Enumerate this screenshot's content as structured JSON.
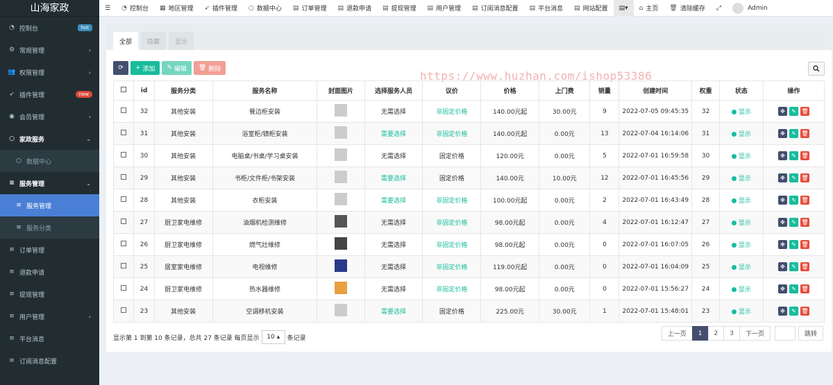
{
  "app": {
    "title": "山海家政"
  },
  "sidebar": {
    "items": [
      {
        "label": "控制台",
        "icon": "dashboard-icon",
        "badge": "hot"
      },
      {
        "label": "常规管理",
        "icon": "cogs-icon"
      },
      {
        "label": "权限管理",
        "icon": "group-icon"
      },
      {
        "label": "插件管理",
        "icon": "rocket-icon",
        "badge": "new"
      },
      {
        "label": "会员管理",
        "icon": "user-circle-icon"
      },
      {
        "label": "家政服务",
        "icon": "circle-icon"
      },
      {
        "label": "数据中心",
        "icon": "circle-outline-icon"
      },
      {
        "label": "服务管理",
        "icon": "list-icon"
      },
      {
        "label": "服务管理",
        "icon": "list-icon"
      },
      {
        "label": "服务分类",
        "icon": "list-icon"
      },
      {
        "label": "订单管理",
        "icon": "list-icon"
      },
      {
        "label": "退款申请",
        "icon": "list-icon"
      },
      {
        "label": "提现管理",
        "icon": "list-icon"
      },
      {
        "label": "用户管理",
        "icon": "list-icon"
      },
      {
        "label": "平台消息",
        "icon": "list-icon"
      },
      {
        "label": "订阅消息配置",
        "icon": "list-icon"
      }
    ]
  },
  "topbar": {
    "items": [
      "控制台",
      "地区管理",
      "插件管理",
      "数据中心",
      "订单管理",
      "退款申请",
      "提现管理",
      "用户管理",
      "订阅消息配置",
      "平台消息",
      "网站配置"
    ],
    "home": "主页",
    "clear_cache": "清除缓存",
    "user": "Admin"
  },
  "tabs": [
    "全部",
    "隐藏",
    "显示"
  ],
  "toolbar": {
    "add": "添加",
    "edit": "编辑",
    "delete": "删除"
  },
  "watermark": "https://www.huzhan.com/ishop53386",
  "table": {
    "headers": [
      "id",
      "服务分类",
      "服务名称",
      "封面图片",
      "选择服务人员",
      "议价",
      "价格",
      "上门费",
      "销量",
      "创建时间",
      "权重",
      "状态",
      "操作"
    ],
    "rows": [
      {
        "id": "32",
        "category": "其他安装",
        "name": "餐边柜安装",
        "staff": "无需选择",
        "bargain": "非固定价格",
        "price": "140.00元起",
        "fee": "30.00元",
        "sales": "9",
        "time": "2022-07-05 09:45:35",
        "weight": "32",
        "status": "显示"
      },
      {
        "id": "31",
        "category": "其他安装",
        "name": "浴室柜/镜柜安装",
        "staff": "需要选择",
        "bargain": "非固定价格",
        "price": "140.00元起",
        "fee": "0.00元",
        "sales": "13",
        "time": "2022-07-04 16:14:06",
        "weight": "31",
        "status": "显示"
      },
      {
        "id": "30",
        "category": "其他安装",
        "name": "电脑桌/书桌/学习桌安装",
        "staff": "无需选择",
        "bargain": "固定价格",
        "price": "120.00元",
        "fee": "0.00元",
        "sales": "5",
        "time": "2022-07-01 16:59:58",
        "weight": "30",
        "status": "显示"
      },
      {
        "id": "29",
        "category": "其他安装",
        "name": "书柜/文件柜/书架安装",
        "staff": "需要选择",
        "bargain": "固定价格",
        "price": "140.00元",
        "fee": "10.00元",
        "sales": "12",
        "time": "2022-07-01 16:45:56",
        "weight": "29",
        "status": "显示"
      },
      {
        "id": "28",
        "category": "其他安装",
        "name": "衣柜安装",
        "staff": "需要选择",
        "bargain": "非固定价格",
        "price": "100.00元起",
        "fee": "0.00元",
        "sales": "2",
        "time": "2022-07-01 16:43:49",
        "weight": "28",
        "status": "显示"
      },
      {
        "id": "27",
        "category": "厨卫家电维修",
        "name": "油烟机检测维修",
        "staff": "无需选择",
        "bargain": "非固定价格",
        "price": "98.00元起",
        "fee": "0.00元",
        "sales": "4",
        "time": "2022-07-01 16:12:47",
        "weight": "27",
        "status": "显示"
      },
      {
        "id": "26",
        "category": "厨卫家电维修",
        "name": "燃气灶维修",
        "staff": "无需选择",
        "bargain": "非固定价格",
        "price": "98.00元起",
        "fee": "0.00元",
        "sales": "0",
        "time": "2022-07-01 16:07:05",
        "weight": "26",
        "status": "显示"
      },
      {
        "id": "25",
        "category": "居室家电维修",
        "name": "电视维修",
        "staff": "无需选择",
        "bargain": "非固定价格",
        "price": "119.00元起",
        "fee": "0.00元",
        "sales": "0",
        "time": "2022-07-01 16:04:09",
        "weight": "25",
        "status": "显示"
      },
      {
        "id": "24",
        "category": "厨卫家电维修",
        "name": "热水器维修",
        "staff": "无需选择",
        "bargain": "非固定价格",
        "price": "98.00元起",
        "fee": "0.00元",
        "sales": "0",
        "time": "2022-07-01 15:56:27",
        "weight": "24",
        "status": "显示"
      },
      {
        "id": "23",
        "category": "其他安装",
        "name": "空调移机安装",
        "staff": "需要选择",
        "bargain": "固定价格",
        "price": "225.00元",
        "fee": "30.00元",
        "sales": "1",
        "time": "2022-07-01 15:48:01",
        "weight": "23",
        "status": "显示"
      }
    ]
  },
  "footer": {
    "info_before": "显示第 1 到第 10 条记录，总共 27 条记录 每页显示",
    "page_size": "10 ▴",
    "info_after": "条记录",
    "prev": "上一页",
    "pages": [
      "1",
      "2",
      "3"
    ],
    "next": "下一页",
    "go": "跳转"
  },
  "colors": {
    "accent": "#18bc9c",
    "sidebar": "#222d32",
    "active": "#4a7fd6"
  }
}
